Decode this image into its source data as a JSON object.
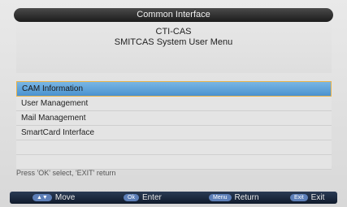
{
  "window": {
    "title": "Common Interface"
  },
  "header": {
    "line1": "CTI-CAS",
    "line2": "SMITCAS System User Menu"
  },
  "menu": {
    "items": [
      {
        "label": "CAM Information",
        "selected": true
      },
      {
        "label": "User Management",
        "selected": false
      },
      {
        "label": "Mail Management",
        "selected": false
      },
      {
        "label": "SmartCard Interface",
        "selected": false
      }
    ]
  },
  "hint": "Press 'OK' select, 'EXIT' return",
  "footer": {
    "move": {
      "key": "▲▼",
      "label": "Move"
    },
    "enter": {
      "key": "Ok",
      "label": "Enter"
    },
    "return": {
      "key": "Menu",
      "label": "Return"
    },
    "exit": {
      "key": "Exit",
      "label": "Exit"
    }
  },
  "colors": {
    "selected_bg": "#4a92cf",
    "selected_border": "#e8b24a",
    "footer_bg": "#0f1a2b"
  }
}
